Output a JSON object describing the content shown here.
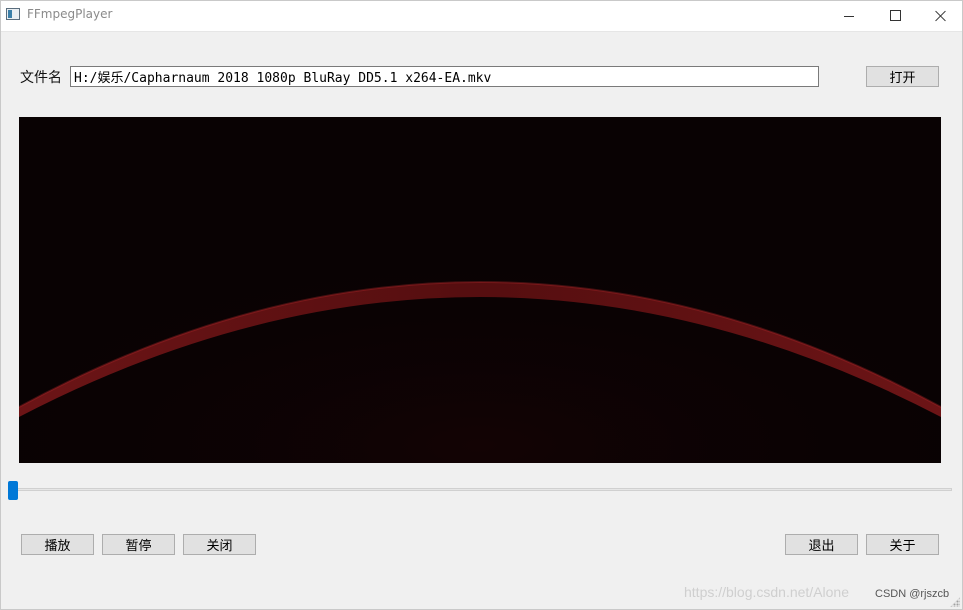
{
  "window": {
    "title": "FFmpegPlayer"
  },
  "file": {
    "label": "文件名",
    "path": "H:/娱乐/Capharnaum 2018 1080p BluRay DD5.1 x264-EA.mkv",
    "open_label": "打开"
  },
  "video": {
    "background_color": "#090203",
    "arc_color": "#7a0f12"
  },
  "progress": {
    "value_percent": 0
  },
  "controls": {
    "play_label": "播放",
    "pause_label": "暂停",
    "close_label": "关闭",
    "exit_label": "退出",
    "about_label": "关于"
  },
  "watermark": {
    "url_text": "https://blog.csdn.net/Alone",
    "csdn_text": "CSDN @rjszcb"
  },
  "colors": {
    "accent": "#0078d7"
  }
}
